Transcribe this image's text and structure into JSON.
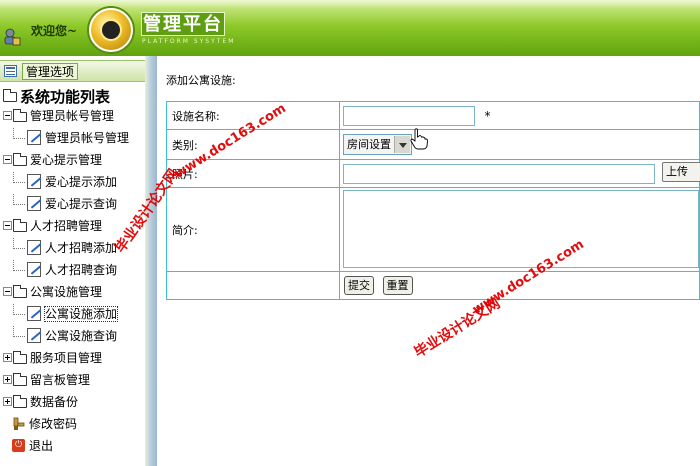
{
  "header": {
    "welcome": "欢迎您~",
    "logo_title": "管理平台",
    "logo_subtitle": "PLATFORM SYSYTEM"
  },
  "sidebar": {
    "menu_head_label": "管理选项",
    "tree_title": "系统功能列表",
    "groups": [
      {
        "label": "管理员帐号管理",
        "items": [
          "管理员帐号管理"
        ]
      },
      {
        "label": "爱心提示管理",
        "items": [
          "爱心提示添加",
          "爱心提示查询"
        ]
      },
      {
        "label": "人才招聘管理",
        "items": [
          "人才招聘添加",
          "人才招聘查询"
        ]
      },
      {
        "label": "公寓设施管理",
        "items": [
          "公寓设施添加",
          "公寓设施查询"
        ]
      },
      {
        "label": "服务项目管理",
        "items": []
      },
      {
        "label": "留言板管理",
        "items": []
      },
      {
        "label": "数据备份",
        "items": []
      }
    ],
    "change_password": "修改密码",
    "logout": "退出"
  },
  "main": {
    "page_title": "添加公寓设施:",
    "fields": {
      "name_label": "设施名称:",
      "name_value": "",
      "required_mark": "*",
      "category_label": "类别:",
      "category_selected": "房间设置",
      "photo_label": "照片:",
      "photo_value": "",
      "upload_label": "上传",
      "intro_label": "简介:",
      "intro_value": ""
    },
    "buttons": {
      "submit": "提交",
      "reset": "重置"
    }
  },
  "watermarks": {
    "site": "www.doc163.com",
    "name": "毕业设计论文网",
    "color": "#e10000"
  },
  "icons": {
    "user": "user-lock-icon",
    "logo": "gauge-logo-icon",
    "menu_head": "list-window-icon",
    "folder": "folder-icon",
    "doc": "document-edit-icon",
    "tool": "wrench-key-icon",
    "exit": "power-icon",
    "cursor": "hand-cursor-icon"
  }
}
